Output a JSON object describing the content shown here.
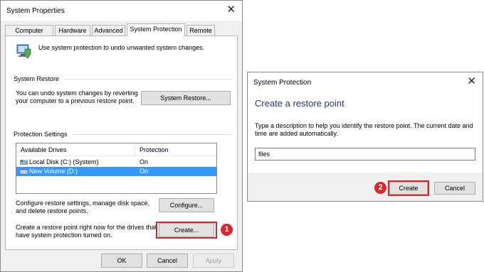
{
  "system_properties": {
    "title": "System Properties",
    "close_glyph": "✕",
    "tabs": [
      {
        "label": "Computer Name"
      },
      {
        "label": "Hardware"
      },
      {
        "label": "Advanced"
      },
      {
        "label": "System Protection",
        "active": true
      },
      {
        "label": "Remote"
      }
    ],
    "intro_text": "Use system protection to undo unwanted system changes.",
    "system_restore": {
      "heading": "System Restore",
      "text_line1": "You can undo system changes by reverting",
      "text_line2": "your computer to a previous restore point.",
      "button_label": "System Restore..."
    },
    "protection_settings": {
      "heading": "Protection Settings",
      "columns": [
        "Available Drives",
        "Protection"
      ],
      "drives": [
        {
          "name": "Local Disk (C:) (System)",
          "protection": "On",
          "icon": "system-drive-icon",
          "selected": false
        },
        {
          "name": "New Volume (D:)",
          "protection": "On",
          "icon": "drive-icon",
          "selected": true
        }
      ],
      "configure_text_line1": "Configure restore settings, manage disk space,",
      "configure_text_line2": "and delete restore points.",
      "configure_button": "Configure...",
      "create_text_line1": "Create a restore point right now for the drives that",
      "create_text_line2": "have system protection turned on.",
      "create_button": "Create..."
    },
    "footer": {
      "ok": "OK",
      "cancel": "Cancel",
      "apply": "Apply"
    }
  },
  "system_protection_dialog": {
    "title": "System Protection",
    "close_glyph": "✕",
    "heading": "Create a restore point",
    "description_line1": "Type a description to help you identify the restore point. The current date and",
    "description_line2": "time are added automatically.",
    "input_value": "files",
    "create_button": "Create",
    "cancel_button": "Cancel"
  },
  "step_badges": [
    "1",
    "2"
  ],
  "colors": {
    "highlight": "#d9272e",
    "selection": "#3399ff",
    "heading_blue": "#1e3a8a"
  }
}
